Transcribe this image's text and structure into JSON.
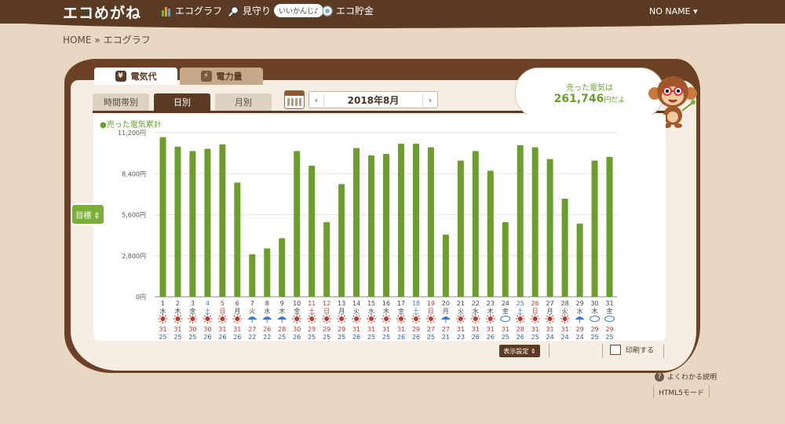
{
  "app": {
    "logo": "エコめがね",
    "user": "NO NAME ▾"
  },
  "nav": [
    {
      "label": "エコグラフ",
      "icon": "graph-icon"
    },
    {
      "label": "見守り",
      "icon": "magnifier-icon"
    },
    {
      "label": "エコ貯金",
      "icon": "coin-icon"
    }
  ],
  "nav_bubble": "いいかんじ♪",
  "breadcrumb": {
    "home": "HOME",
    "sep": "»",
    "current": "エコグラフ"
  },
  "main_tabs": [
    {
      "label": "電気代",
      "icon": "¥"
    },
    {
      "label": "電力量",
      "icon": "⚡"
    }
  ],
  "sub_tabs": [
    "時間帯別",
    "日別",
    "月別"
  ],
  "date": {
    "label": "2018年8月",
    "prev": "‹",
    "next": "›"
  },
  "sold": {
    "line1": "売った電気は",
    "amount": "261,746",
    "unit": "円だよ"
  },
  "legend": "●売った電気累計",
  "target_button": "目標 ⇕",
  "show_settings": "表示設定 ⇕",
  "print": "印刷する",
  "help": "よくわかる説明",
  "html5": "HTML5モード",
  "colors": {
    "bar": "#6b9e2a",
    "brown": "#5b3b24",
    "holiday": "#c0392b",
    "saturday": "#3a7bd5",
    "high": "#c0392b",
    "low": "#2c5fa8"
  },
  "chart_data": {
    "type": "bar",
    "ylim": [
      0,
      11200
    ],
    "yticks": [
      "0円",
      "2,800円",
      "5,600円",
      "8,400円",
      "11,200円"
    ],
    "ytick_values": [
      0,
      2800,
      5600,
      8400,
      11200
    ],
    "categories": [
      "1",
      "2",
      "3",
      "4",
      "5",
      "6",
      "7",
      "8",
      "9",
      "10",
      "11",
      "12",
      "13",
      "14",
      "15",
      "16",
      "17",
      "18",
      "19",
      "20",
      "21",
      "22",
      "23",
      "24",
      "25",
      "26",
      "27",
      "28",
      "29",
      "30",
      "31"
    ],
    "weekdays": [
      "水",
      "木",
      "金",
      "土",
      "日",
      "月",
      "火",
      "水",
      "木",
      "金",
      "土",
      "日",
      "月",
      "火",
      "水",
      "木",
      "金",
      "土",
      "日",
      "月",
      "火",
      "水",
      "木",
      "金",
      "土",
      "日",
      "月",
      "火",
      "水",
      "木",
      "金"
    ],
    "day_types": [
      "w",
      "w",
      "w",
      "sat",
      "hol",
      "w",
      "w",
      "w",
      "w",
      "w",
      "hol",
      "hol",
      "w",
      "w",
      "w",
      "w",
      "w",
      "sat",
      "hol",
      "w",
      "w",
      "w",
      "w",
      "w",
      "sat",
      "hol",
      "w",
      "w",
      "w",
      "w",
      "w"
    ],
    "values": [
      10900,
      10250,
      9950,
      10100,
      10400,
      7800,
      2900,
      3300,
      4000,
      9950,
      8950,
      5100,
      7700,
      10150,
      9650,
      9750,
      10450,
      10450,
      10200,
      4250,
      9300,
      9950,
      8600,
      5100,
      10350,
      10200,
      9400,
      6700,
      5000,
      9300,
      9550
    ],
    "weather": [
      "sun",
      "sun",
      "sun",
      "sun",
      "sun",
      "sun",
      "rain",
      "rain",
      "rain",
      "sun",
      "sun",
      "sun",
      "sun",
      "sun",
      "sun",
      "sun",
      "sun",
      "sun",
      "sun",
      "rain",
      "sun",
      "sun",
      "sun",
      "cloud",
      "sun",
      "sun",
      "sun",
      "sun",
      "rain",
      "cloud",
      "cloud"
    ],
    "temp_high": [
      "31",
      "31",
      "30",
      "30",
      "31",
      "31",
      "27",
      "26",
      "28",
      "30",
      "29",
      "29",
      "29",
      "31",
      "31",
      "31",
      "31",
      "29",
      "27",
      "27",
      "31",
      "31",
      "31",
      "31",
      "28",
      "31",
      "31",
      "31",
      "29",
      "29",
      "29"
    ],
    "temp_low": [
      "25",
      "25",
      "25",
      "26",
      "26",
      "26",
      "22",
      "22",
      "25",
      "26",
      "25",
      "25",
      "25",
      "26",
      "25",
      "25",
      "26",
      "26",
      "25",
      "21",
      "23",
      "26",
      "26",
      "25",
      "26",
      "25",
      "24",
      "24",
      "24",
      "25",
      "25"
    ]
  }
}
